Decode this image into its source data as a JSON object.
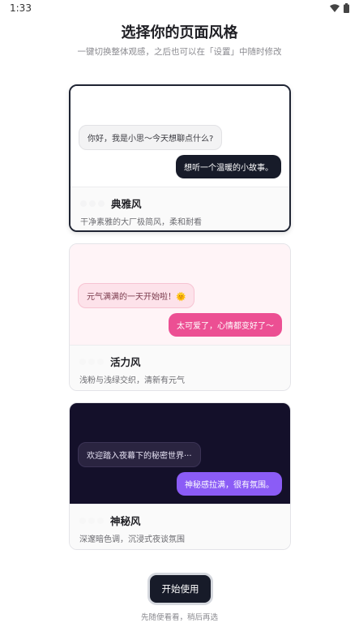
{
  "status_bar": {
    "time": "1:33",
    "icons": [
      "wifi-icon",
      "battery-icon"
    ]
  },
  "header": {
    "title": "选择你的页面风格",
    "subtitle": "一键切换整体观感，之后也可以在「设置」中随时修改"
  },
  "styles": [
    {
      "id": "classic",
      "name": "典雅风",
      "description": "干净素雅的大厂极简风，柔和耐看",
      "selected": true,
      "bot_message": "你好，我是小思～今天想聊点什么?",
      "user_message": "想听一个温暖的小故事。",
      "colors": {
        "background": "#ffffff",
        "accent": "#171b29"
      }
    },
    {
      "id": "vibrant",
      "name": "活力风",
      "description": "浅粉与浅绿交织，清新有元气",
      "selected": false,
      "bot_message": "元气满满的一天开始啦！🌞",
      "user_message": "太可爱了，心情都变好了〜",
      "colors": {
        "background": "#fff4f7",
        "accent": "#ec4f93"
      }
    },
    {
      "id": "mystery",
      "name": "神秘风",
      "description": "深邃暗色调，沉浸式夜谈氛围",
      "selected": false,
      "bot_message": "欢迎踏入夜幕下的秘密世界···",
      "user_message": "神秘感拉满，很有氛围。",
      "colors": {
        "background": "#14102a",
        "accent": "#8b5cf6"
      }
    }
  ],
  "footer": {
    "start_label": "开始使用",
    "skip_label": "先随便看看，稍后再选"
  }
}
